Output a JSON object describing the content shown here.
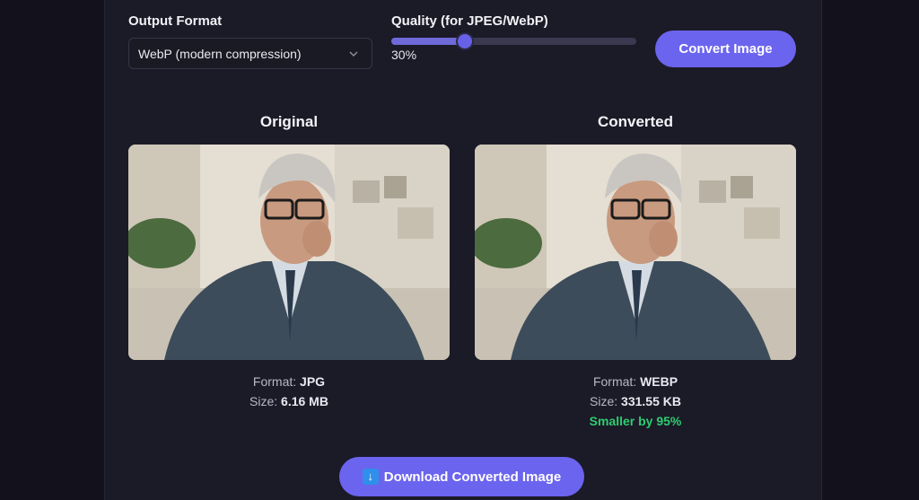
{
  "controls": {
    "format_label": "Output Format",
    "format_value": "WebP (modern compression)",
    "quality_label": "Quality (for JPEG/WebP)",
    "quality_value": "30%",
    "quality_fraction": 0.3,
    "convert_label": "Convert Image"
  },
  "original": {
    "title": "Original",
    "format_prefix": "Format: ",
    "format": "JPG",
    "size_prefix": "Size: ",
    "size": "6.16 MB"
  },
  "converted": {
    "title": "Converted",
    "format_prefix": "Format: ",
    "format": "WEBP",
    "size_prefix": "Size: ",
    "size": "331.55 KB",
    "smaller_note": "Smaller by 95%"
  },
  "download": {
    "icon": "down-arrow-icon",
    "label": "Download Converted Image"
  },
  "colors": {
    "accent": "#6b64ee",
    "success": "#2ecc71",
    "background": "#13121c"
  }
}
